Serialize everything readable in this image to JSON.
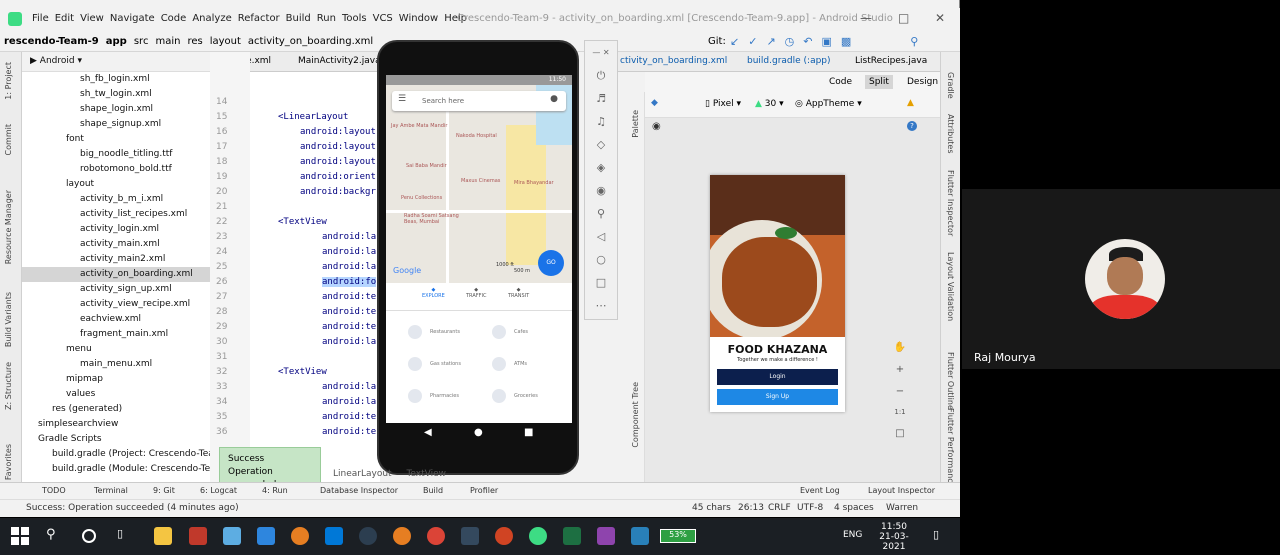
{
  "title_bar": {
    "menus": [
      "File",
      "Edit",
      "View",
      "Navigate",
      "Code",
      "Analyze",
      "Refactor",
      "Build",
      "Run",
      "Tools",
      "VCS",
      "Window",
      "Help"
    ],
    "window_title": "Crescendo-Team-9 - activity_on_boarding.xml [Crescendo-Team-9.app] - Android Studio"
  },
  "nav": {
    "project": "rescendo-Team-9",
    "module": "app",
    "src": "src",
    "main": "main",
    "res": "res",
    "layout": "layout",
    "file": "activity_on_boarding.xml",
    "git": "Git:"
  },
  "project_panel": {
    "view": "Android",
    "items": [
      {
        "label": "sh_fb_login.xml",
        "indent": 4
      },
      {
        "label": "sh_tw_login.xml",
        "indent": 4
      },
      {
        "label": "shape_login.xml",
        "indent": 4
      },
      {
        "label": "shape_signup.xml",
        "indent": 4
      },
      {
        "label": "font",
        "indent": 3
      },
      {
        "label": "big_noodle_titling.ttf",
        "indent": 4
      },
      {
        "label": "robotomono_bold.ttf",
        "indent": 4
      },
      {
        "label": "layout",
        "indent": 3
      },
      {
        "label": "activity_b_m_i.xml",
        "indent": 4
      },
      {
        "label": "activity_list_recipes.xml",
        "indent": 4
      },
      {
        "label": "activity_login.xml",
        "indent": 4
      },
      {
        "label": "activity_main.xml",
        "indent": 4
      },
      {
        "label": "activity_main2.xml",
        "indent": 4
      },
      {
        "label": "activity_on_boarding.xml",
        "indent": 4,
        "selected": true
      },
      {
        "label": "activity_sign_up.xml",
        "indent": 4
      },
      {
        "label": "activity_view_recipe.xml",
        "indent": 4
      },
      {
        "label": "eachview.xml",
        "indent": 4
      },
      {
        "label": "fragment_main.xml",
        "indent": 4
      },
      {
        "label": "menu",
        "indent": 3
      },
      {
        "label": "main_menu.xml",
        "indent": 4
      },
      {
        "label": "mipmap",
        "indent": 3
      },
      {
        "label": "values",
        "indent": 3
      },
      {
        "label": "res (generated)",
        "indent": 2
      },
      {
        "label": "simplesearchview",
        "indent": 1
      },
      {
        "label": "Gradle Scripts",
        "indent": 1
      },
      {
        "label": "build.gradle (Project: Crescendo-Tea",
        "indent": 2
      },
      {
        "label": "build.gradle (Module: Crescendo-Te",
        "indent": 2
      }
    ]
  },
  "left_tabs": [
    "1: Project",
    "Commit",
    "Resource Manager",
    "Build Variants",
    "Z: Structure",
    "2: Favorites"
  ],
  "editor": {
    "tabs": [
      "w_recipe.xml",
      "MainActivity2.java"
    ],
    "lines": [
      "14",
      "15",
      "16",
      "17",
      "18",
      "19",
      "20",
      "21",
      "22",
      "23",
      "24",
      "25",
      "26",
      "27",
      "28",
      "29",
      "30",
      "31",
      "32",
      "33",
      "34",
      "35",
      "36"
    ],
    "code": [
      "",
      "<LinearLayout",
      "android:layout",
      "android:layout",
      "android:layout",
      "android:orient",
      "android:backgr",
      "",
      "<TextView",
      "android:la",
      "android:la",
      "android:la",
      "android:fo",
      "android:te",
      "android:te",
      "android:te",
      "android:la",
      "",
      "<TextView",
      "android:la",
      "android:la",
      "android:te",
      "android:te"
    ]
  },
  "right_tabs": [
    "ctivity_on_boarding.xml",
    "build.gradle (:app)",
    "ListRecipes.java"
  ],
  "design": {
    "modes": [
      "Code",
      "Split",
      "Design"
    ],
    "device": "Pixel",
    "api": "30",
    "theme": "AppTheme",
    "app_name": "FOOD KHAZANA",
    "tagline": "Together we make a difference !",
    "login": "Login",
    "signup": "Sign Up",
    "palette": "Palette",
    "component_tree": "Component Tree"
  },
  "right_strip": [
    "Gradle",
    "Attributes",
    "Flutter Inspector",
    "Layout Validation",
    "Flutter Outline",
    "Flutter Performance"
  ],
  "phone": {
    "status_time": "11:50",
    "search_placeholder": "Search here",
    "places": [
      "Jay Ambe Mata Mandir",
      "Nakoda Hospital",
      "Sai Baba Mandir",
      "Maxus Cinemas",
      "Penu Collections",
      "Mira Bhayandar",
      "Radha Soami Satsang Beas, Mumbai"
    ],
    "scale": [
      "1000 ft",
      "500 m"
    ],
    "google": "Google",
    "tabs": [
      "EXPLORE",
      "TRAFFIC",
      "TRANSIT"
    ],
    "categories": [
      "Restaurants",
      "Cafes",
      "Gas stations",
      "ATMs",
      "Pharmacies",
      "Groceries"
    ],
    "go": "GO"
  },
  "toast": {
    "title": "Success",
    "message": "Operation succeeded"
  },
  "breadcrumb_bottom": [
    "LinearLayout",
    "TextView"
  ],
  "bottom_tools": [
    "TODO",
    "Terminal",
    "9: Git",
    "6: Logcat",
    "4: Run",
    "Database Inspector",
    "Build",
    "Profiler",
    "Event Log",
    "Layout Inspector"
  ],
  "status": {
    "message": "Success: Operation succeeded (4 minutes ago)",
    "chars": "45 chars",
    "pos": "26:13",
    "eol": "CRLF",
    "enc": "UTF-8",
    "indent": "4 spaces",
    "warn": "Warren"
  },
  "taskbar": {
    "battery": "53%",
    "lang": "ENG",
    "time": "11:50",
    "date": "21-03-2021"
  },
  "participant": {
    "name": "Raj Mourya"
  }
}
